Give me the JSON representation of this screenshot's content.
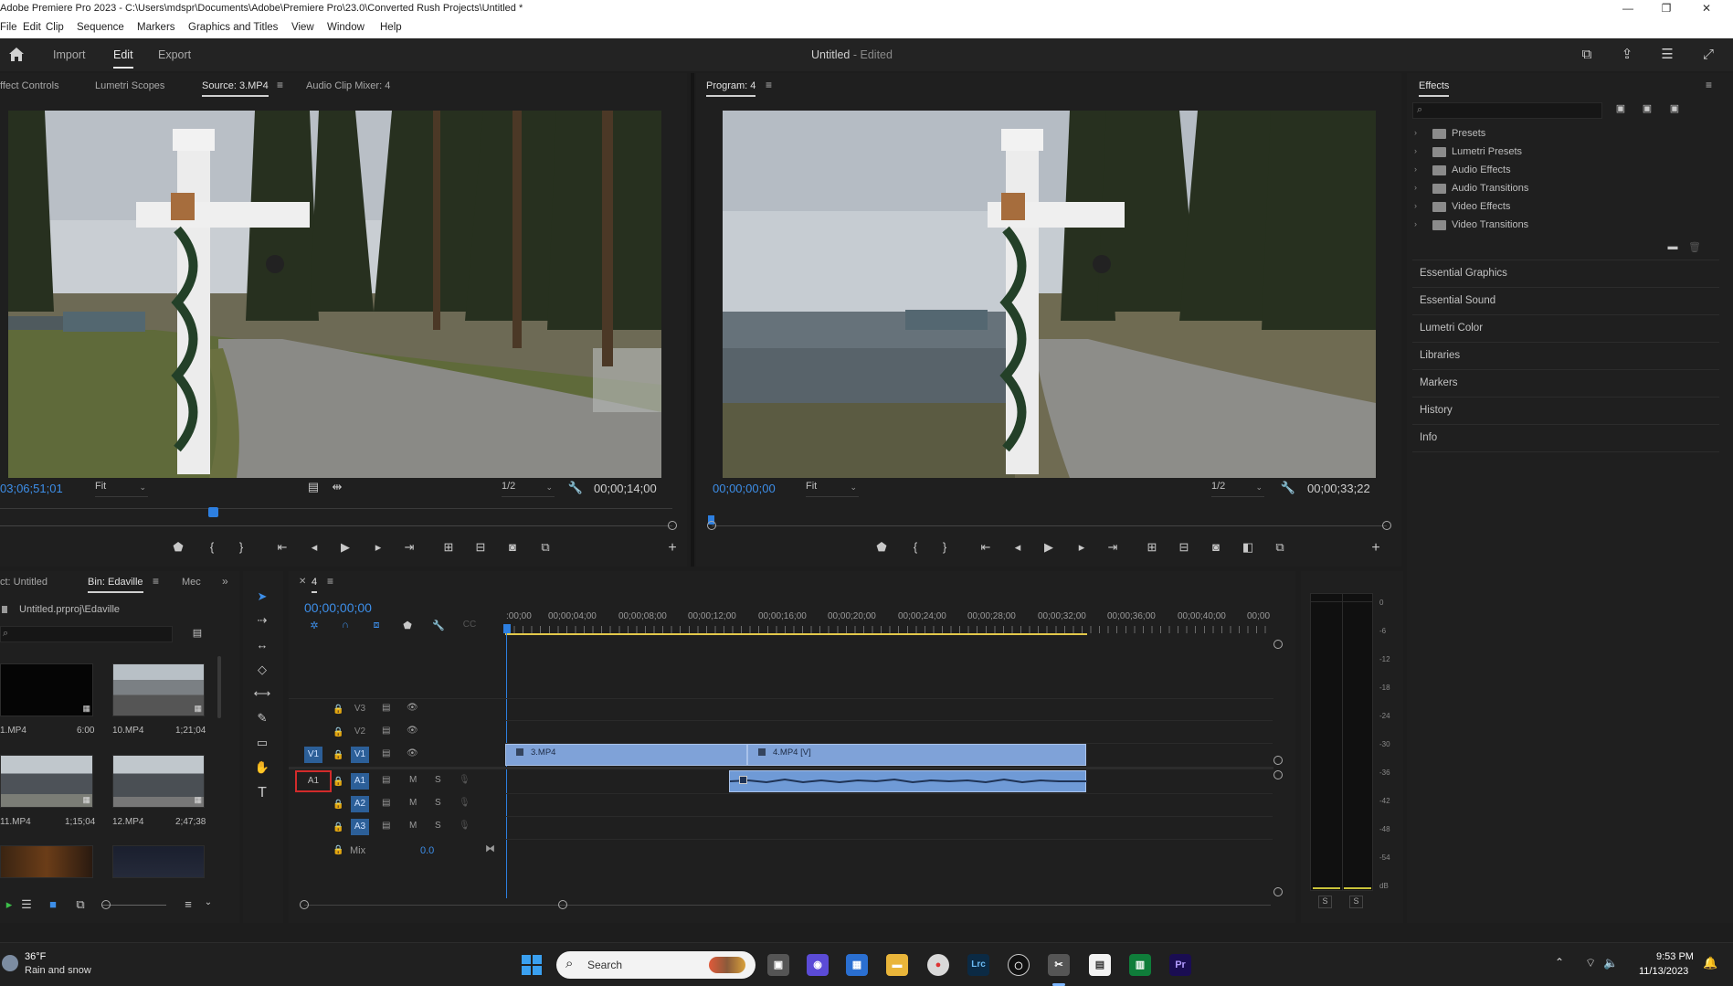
{
  "window": {
    "title": "Adobe Premiere Pro 2023 - C:\\Users\\mdspr\\Documents\\Adobe\\Premiere Pro\\23.0\\Converted Rush Projects\\Untitled *",
    "minimize": "—",
    "maximize": "❐",
    "close": "✕"
  },
  "menu": [
    "File",
    "Edit",
    "Clip",
    "Sequence",
    "Markers",
    "Graphics and Titles",
    "View",
    "Window",
    "Help"
  ],
  "header": {
    "workspaces": [
      "Import",
      "Edit",
      "Export"
    ],
    "active_workspace": "Edit",
    "doc_title": "Untitled",
    "doc_status": "- Edited"
  },
  "source_panel": {
    "tabs": [
      "ffect Controls",
      "Lumetri Scopes",
      "Source: 3.MP4",
      "Audio Clip Mixer: 4"
    ],
    "active_tab": "Source: 3.MP4",
    "timecode": "03;06;51;01",
    "fit": "Fit",
    "resolution": "1/2",
    "duration": "00;00;14;00",
    "playhead_fraction": 0.31
  },
  "program_panel": {
    "tab": "Program: 4",
    "timecode": "00;00;00;00",
    "fit": "Fit",
    "resolution": "1/2",
    "duration": "00;00;33;22"
  },
  "effects_panel": {
    "title": "Effects",
    "folders": [
      "Presets",
      "Lumetri Presets",
      "Audio Effects",
      "Audio Transitions",
      "Video Effects",
      "Video Transitions"
    ],
    "sections": [
      "Essential Graphics",
      "Essential Sound",
      "Lumetri Color",
      "Libraries",
      "Markers",
      "History",
      "Info"
    ]
  },
  "project_panel": {
    "tabs": [
      "ct: Untitled",
      "Bin: Edaville",
      "Mec"
    ],
    "active_tab": "Bin: Edaville",
    "path": "Untitled.prproj\\Edaville",
    "items": [
      {
        "name": "1.MP4",
        "duration": "6:00"
      },
      {
        "name": "10.MP4",
        "duration": "1;21;04"
      },
      {
        "name": "11.MP4",
        "duration": "1;15;04"
      },
      {
        "name": "12.MP4",
        "duration": "2;47;38"
      }
    ]
  },
  "timeline": {
    "tab": "4",
    "timecode": "00;00;00;00",
    "ruler": [
      ":00;00",
      "00;00;04;00",
      "00;00;08;00",
      "00;00;12;00",
      "00;00;16;00",
      "00;00;20;00",
      "00;00;24;00",
      "00;00;28;00",
      "00;00;32;00",
      "00;00;36;00",
      "00;00;40;00",
      "00;00"
    ],
    "video_tracks": [
      "V3",
      "V2",
      "V1"
    ],
    "audio_tracks": [
      "A1",
      "A2",
      "A3"
    ],
    "source_v": "V1",
    "source_a": "A1",
    "mix_label": "Mix",
    "mix_value": "0.0",
    "clips": [
      "3.MP4",
      "4.MP4 [V]"
    ],
    "m": "M",
    "s": "S"
  },
  "meter": {
    "scale": [
      "0",
      "-6",
      "-12",
      "-18",
      "-24",
      "-30",
      "-36",
      "-42",
      "-48",
      "-54",
      "dB"
    ],
    "solo": "S"
  },
  "taskbar": {
    "weather_temp": "36°F",
    "weather_desc": "Rain and snow",
    "search": "Search",
    "time": "9:53 PM",
    "date": "11/13/2023",
    "apps": [
      "Lrc",
      "Pr"
    ]
  }
}
